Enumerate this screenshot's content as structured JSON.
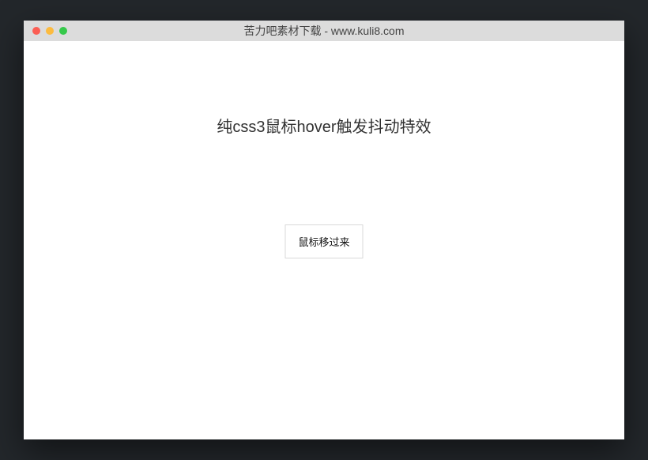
{
  "window": {
    "title": "苦力吧素材下载 - www.kuli8.com"
  },
  "content": {
    "heading": "纯css3鼠标hover触发抖动特效",
    "button_label": "鼠标移过来"
  }
}
